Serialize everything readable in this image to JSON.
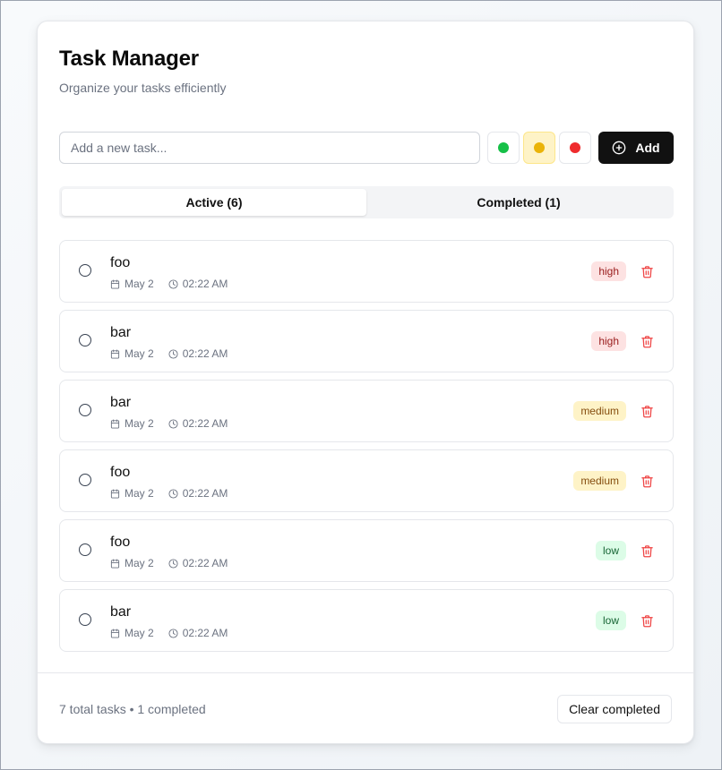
{
  "header": {
    "title": "Task Manager",
    "subtitle": "Organize your tasks efficiently"
  },
  "add_form": {
    "placeholder": "Add a new task...",
    "value": "",
    "priority_options": [
      {
        "name": "low",
        "color": "#16c047"
      },
      {
        "name": "medium",
        "color": "#eab308",
        "selected": true
      },
      {
        "name": "high",
        "color": "#ef2b2d"
      }
    ],
    "add_label": "Add"
  },
  "tabs": [
    {
      "label": "Active (6)",
      "active": true
    },
    {
      "label": "Completed (1)",
      "active": false
    }
  ],
  "tasks": [
    {
      "title": "foo",
      "date": "May 2",
      "time": "02:22 AM",
      "priority": "high"
    },
    {
      "title": "bar",
      "date": "May 2",
      "time": "02:22 AM",
      "priority": "high"
    },
    {
      "title": "bar",
      "date": "May 2",
      "time": "02:22 AM",
      "priority": "medium"
    },
    {
      "title": "foo",
      "date": "May 2",
      "time": "02:22 AM",
      "priority": "medium"
    },
    {
      "title": "foo",
      "date": "May 2",
      "time": "02:22 AM",
      "priority": "low"
    },
    {
      "title": "bar",
      "date": "May 2",
      "time": "02:22 AM",
      "priority": "low"
    }
  ],
  "footer": {
    "summary": "7 total tasks • 1 completed",
    "clear_label": "Clear completed"
  },
  "icons": {
    "add": "plus-circle-icon",
    "date": "calendar-icon",
    "time": "clock-icon",
    "delete": "trash-icon",
    "complete": "circle-checkbox-icon"
  },
  "colors": {
    "primary": "#111111",
    "danger": "#ef4444",
    "high_badge_bg": "#fde2e2",
    "medium_badge_bg": "#fef3c7",
    "low_badge_bg": "#dcfce7"
  }
}
